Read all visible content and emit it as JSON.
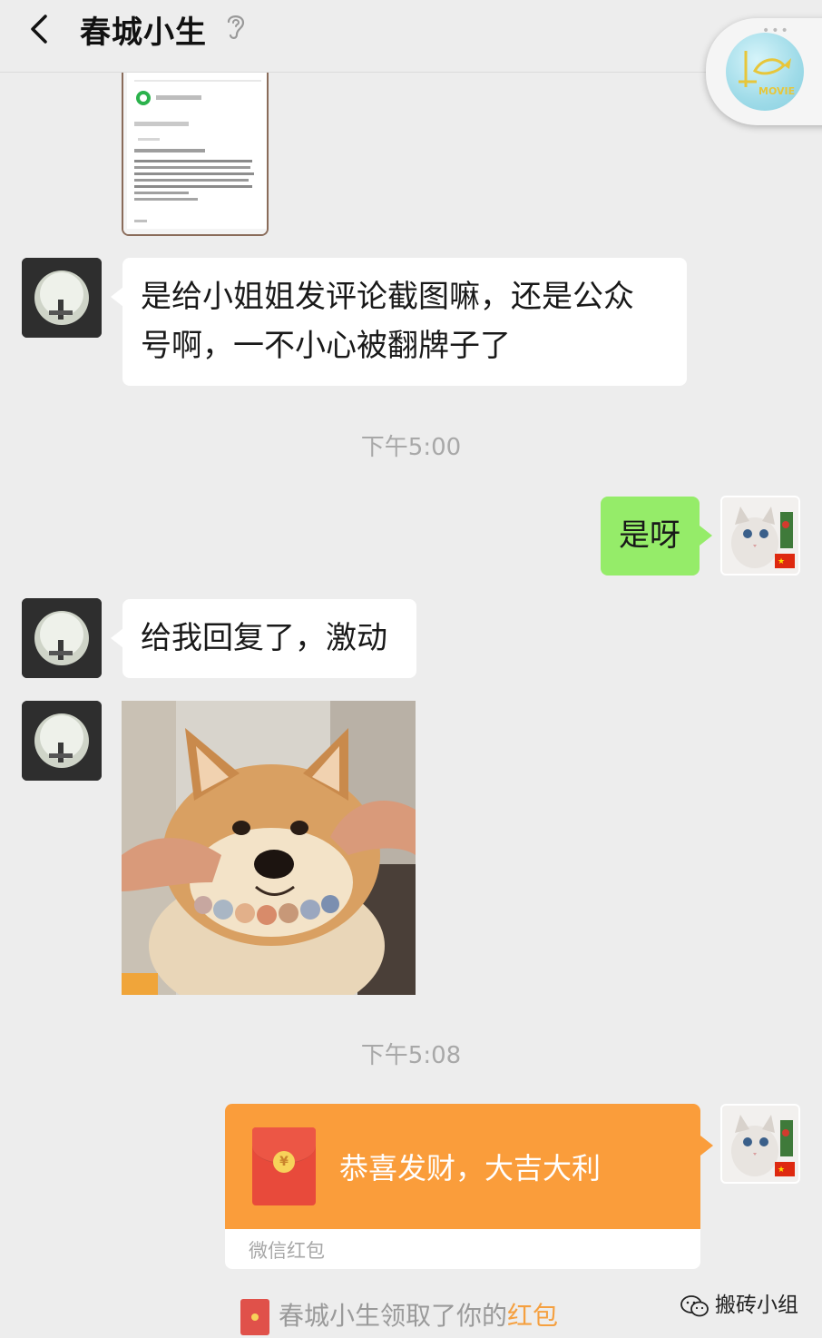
{
  "header": {
    "title": "春城小生"
  },
  "messages": [
    {
      "id": "m1",
      "side": "in",
      "text_line1": "是给小姐姐发评论截图嘛，还是公众",
      "text_line2": "号啊，一不小心被翻牌子了"
    },
    {
      "id": "m2",
      "side": "out",
      "text": "是呀"
    },
    {
      "id": "m3",
      "side": "in",
      "text": "给我回复了，激动"
    }
  ],
  "timestamps": {
    "t1": "下午5:00",
    "t2": "下午5:08"
  },
  "red_packet": {
    "title": "恭喜发财，大吉大利",
    "footer": "微信红包",
    "coin_symbol": "¥"
  },
  "system_notice": {
    "text": "春城小生领取了你的",
    "link": "红包"
  },
  "watermark": {
    "text": "搬砖小组"
  },
  "colors": {
    "background": "#ededed",
    "bubble_out": "#95ec69",
    "bubble_in": "#ffffff",
    "red_packet": "#fa9d3b",
    "accent_link": "#f5a040"
  }
}
